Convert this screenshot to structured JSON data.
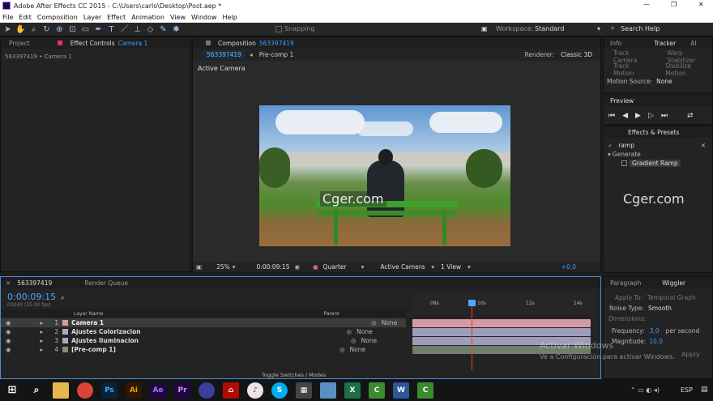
{
  "titlebar": {
    "title": "Adobe After Effects CC 2015 - C:\\Users\\carlo\\Desktop\\Post.aep *",
    "min": "—",
    "max": "❐",
    "close": "✕"
  },
  "menu": [
    "File",
    "Edit",
    "Composition",
    "Layer",
    "Effect",
    "Animation",
    "View",
    "Window",
    "Help"
  ],
  "toolbar": {
    "snapping": "Snapping",
    "workspace_label": "Workspace:",
    "workspace_value": "Standard",
    "search_placeholder": "Search Help"
  },
  "left_panel": {
    "tab_project": "Project",
    "tab_effect_controls": "Effect Controls",
    "effect_target": "Camera 1",
    "subtitle": "563397419 • Camera 1"
  },
  "comp": {
    "tab_label": "Composition",
    "comp_name": "563397419",
    "breadcrumb_1": "563397419",
    "breadcrumb_2": "Pre-comp 1",
    "renderer_label": "Renderer:",
    "renderer_value": "Classic 3D",
    "view_label": "Active Camera",
    "watermark": "Cger.com",
    "zoom": "25%",
    "timecode": "0:00:09:15",
    "resolution": "Quarter",
    "camera": "Active Camera",
    "views": "1 View",
    "exposure": "+0,0"
  },
  "right": {
    "tab_info": "Info",
    "tab_tracker": "Tracker",
    "tab_a": "Al",
    "track_camera": "Track Camera",
    "warp_stabilizer": "Warp Stabilizer",
    "track_motion": "Track Motion",
    "stabilize_motion": "Stabilize Motion",
    "motion_source_label": "Motion Source:",
    "motion_source_value": "None",
    "preview_tab": "Preview",
    "effects_tab": "Effects & Presets",
    "effects_search": "ramp",
    "category": "Generate",
    "effect_item": "Gradient Ramp",
    "watermark": "Cger.com",
    "paragraph_tab": "Paragraph",
    "wiggler_tab": "Wiggler",
    "apply_to_label": "Apply To:",
    "apply_to_value": "Temporal Graph",
    "noise_type_label": "Noise Type:",
    "noise_type_value": "Smooth",
    "dimensions_label": "Dimensions:",
    "frequency_label": "Frequency:",
    "frequency_value": "3,0",
    "frequency_unit": "per second",
    "magnitude_label": "Magnitude:",
    "magnitude_value": "10,0",
    "apply_btn": "Apply"
  },
  "timeline": {
    "tab_comp": "563397419",
    "tab_render": "Render Queue",
    "timecode": "0:00:09:15",
    "frames": "00240 (25.00 fps)",
    "col_layer": "Layer Name",
    "col_parent": "Parent",
    "toggle": "Toggle Switches / Modes",
    "ruler": [
      "08s",
      "10s",
      "12s",
      "14s"
    ],
    "layers": [
      {
        "num": "1",
        "name": "Camera 1",
        "parent": "None",
        "color": "#d99aa6"
      },
      {
        "num": "2",
        "name": "Ajustes Colorizacion",
        "parent": "None",
        "color": "#a9a9c7"
      },
      {
        "num": "3",
        "name": "Ajustes Iluminacion",
        "parent": "None",
        "color": "#a9a9c7"
      },
      {
        "num": "4",
        "name": "[Pre-comp 1]",
        "parent": "None",
        "color": "#7c8f7b"
      }
    ]
  },
  "activate": {
    "line1": "Activar Windows",
    "line2": "Ve a Configuración para activar Windows."
  },
  "taskbar": {
    "language": "ESP"
  }
}
